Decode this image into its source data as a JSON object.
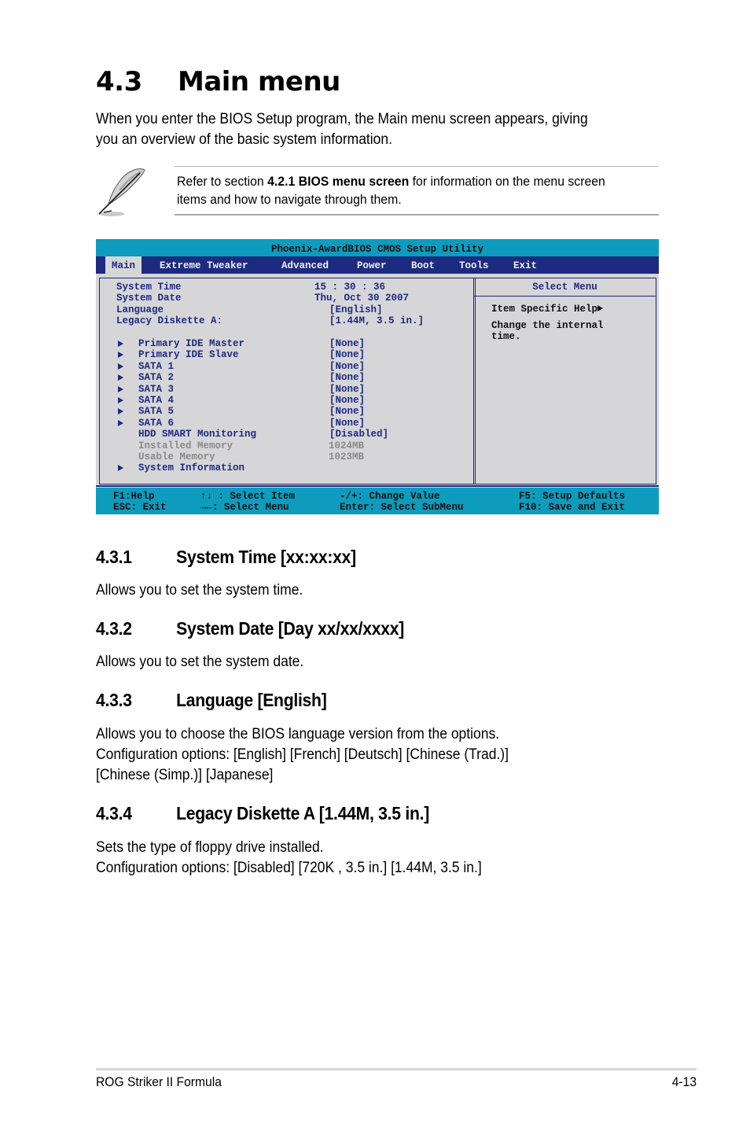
{
  "section": {
    "number": "4.3",
    "title": "Main menu",
    "intro": [
      "When you enter the BIOS Setup program, the Main menu screen appears, giving",
      "you an overview of the basic system information."
    ]
  },
  "note": {
    "icon": "feather-pen-icon",
    "prefix": "Refer to section ",
    "bold": "4.2.1 BIOS menu screen",
    "suffix": " for information on the menu screen",
    "line2": "items and how to navigate through them."
  },
  "bios": {
    "title": "Phoenix-AwardBIOS CMOS Setup Utility",
    "tabs": [
      "Main",
      "Extreme Tweaker",
      "Advanced",
      "Power",
      "Boot",
      "Tools",
      "Exit"
    ],
    "active_tab": "Main",
    "colors": {
      "title_bar": "#0d9cbd",
      "menu_bar": "#1c2a80",
      "panel": "#d6d6d8",
      "text": "#1c2a80",
      "disabled_text": "#8a8a8a"
    },
    "items": [
      {
        "label": "System Time",
        "value": "15 : 30 : 36",
        "submenu": false,
        "disabled": false
      },
      {
        "label": "System Date",
        "value": "Thu, Oct 30 2007",
        "submenu": false,
        "disabled": false
      },
      {
        "label": "Language",
        "value": "[English]",
        "submenu": false,
        "disabled": false
      },
      {
        "label": "Legacy Diskette A:",
        "value": "[1.44M, 3.5 in.]",
        "submenu": false,
        "disabled": false
      },
      {
        "label": "Primary IDE Master",
        "value": "[None]",
        "submenu": true,
        "disabled": false
      },
      {
        "label": "Primary IDE Slave",
        "value": "[None]",
        "submenu": true,
        "disabled": false
      },
      {
        "label": "SATA 1",
        "value": "[None]",
        "submenu": true,
        "disabled": false
      },
      {
        "label": "SATA 2",
        "value": "[None]",
        "submenu": true,
        "disabled": false
      },
      {
        "label": "SATA 3",
        "value": "[None]",
        "submenu": true,
        "disabled": false
      },
      {
        "label": "SATA 4",
        "value": "[None]",
        "submenu": true,
        "disabled": false
      },
      {
        "label": "SATA 5",
        "value": "[None]",
        "submenu": true,
        "disabled": false
      },
      {
        "label": "SATA 6",
        "value": "[None]",
        "submenu": true,
        "disabled": false
      },
      {
        "label": "HDD SMART Monitoring",
        "value": "[Disabled]",
        "submenu": false,
        "disabled": false
      },
      {
        "label": "Installed Memory",
        "value": "1024MB",
        "submenu": false,
        "disabled": true
      },
      {
        "label": "Usable Memory",
        "value": "1023MB",
        "submenu": false,
        "disabled": true
      },
      {
        "label": "System Information",
        "value": "",
        "submenu": true,
        "disabled": false
      }
    ],
    "help": {
      "header": "Select Menu",
      "item_specific": "Item Specific Help",
      "text": [
        "Change the internal",
        "time."
      ]
    },
    "footer": {
      "f1": "F1:Help",
      "esc": "ESC: Exit",
      "select_item": "↑↓ : Select Item",
      "select_menu": "→←: Select Menu",
      "change_value": "-/+: Change Value",
      "enter": "Enter: Select SubMenu",
      "f5": "F5: Setup Defaults",
      "f10": "F10: Save and Exit"
    }
  },
  "subsections": [
    {
      "number": "4.3.1",
      "title": "System Time [xx:xx:xx]",
      "body": [
        "Allows you to set the system time."
      ]
    },
    {
      "number": "4.3.2",
      "title": "System Date [Day xx/xx/xxxx]",
      "body": [
        "Allows you to set the system date."
      ]
    },
    {
      "number": "4.3.3",
      "title": "Language [English]",
      "body": [
        "Allows you to choose the BIOS language version from the options.",
        "Configuration options: [English] [French] [Deutsch] [Chinese (Trad.)]",
        "[Chinese (Simp.)] [Japanese]"
      ]
    },
    {
      "number": "4.3.4",
      "title": "Legacy Diskette A [1.44M, 3.5 in.]",
      "body": [
        "Sets the type of floppy drive installed.",
        "Configuration options: [Disabled] [720K , 3.5 in.] [1.44M, 3.5 in.]"
      ]
    }
  ],
  "page_footer": {
    "left": "ROG Striker II Formula",
    "right": "4-13"
  }
}
